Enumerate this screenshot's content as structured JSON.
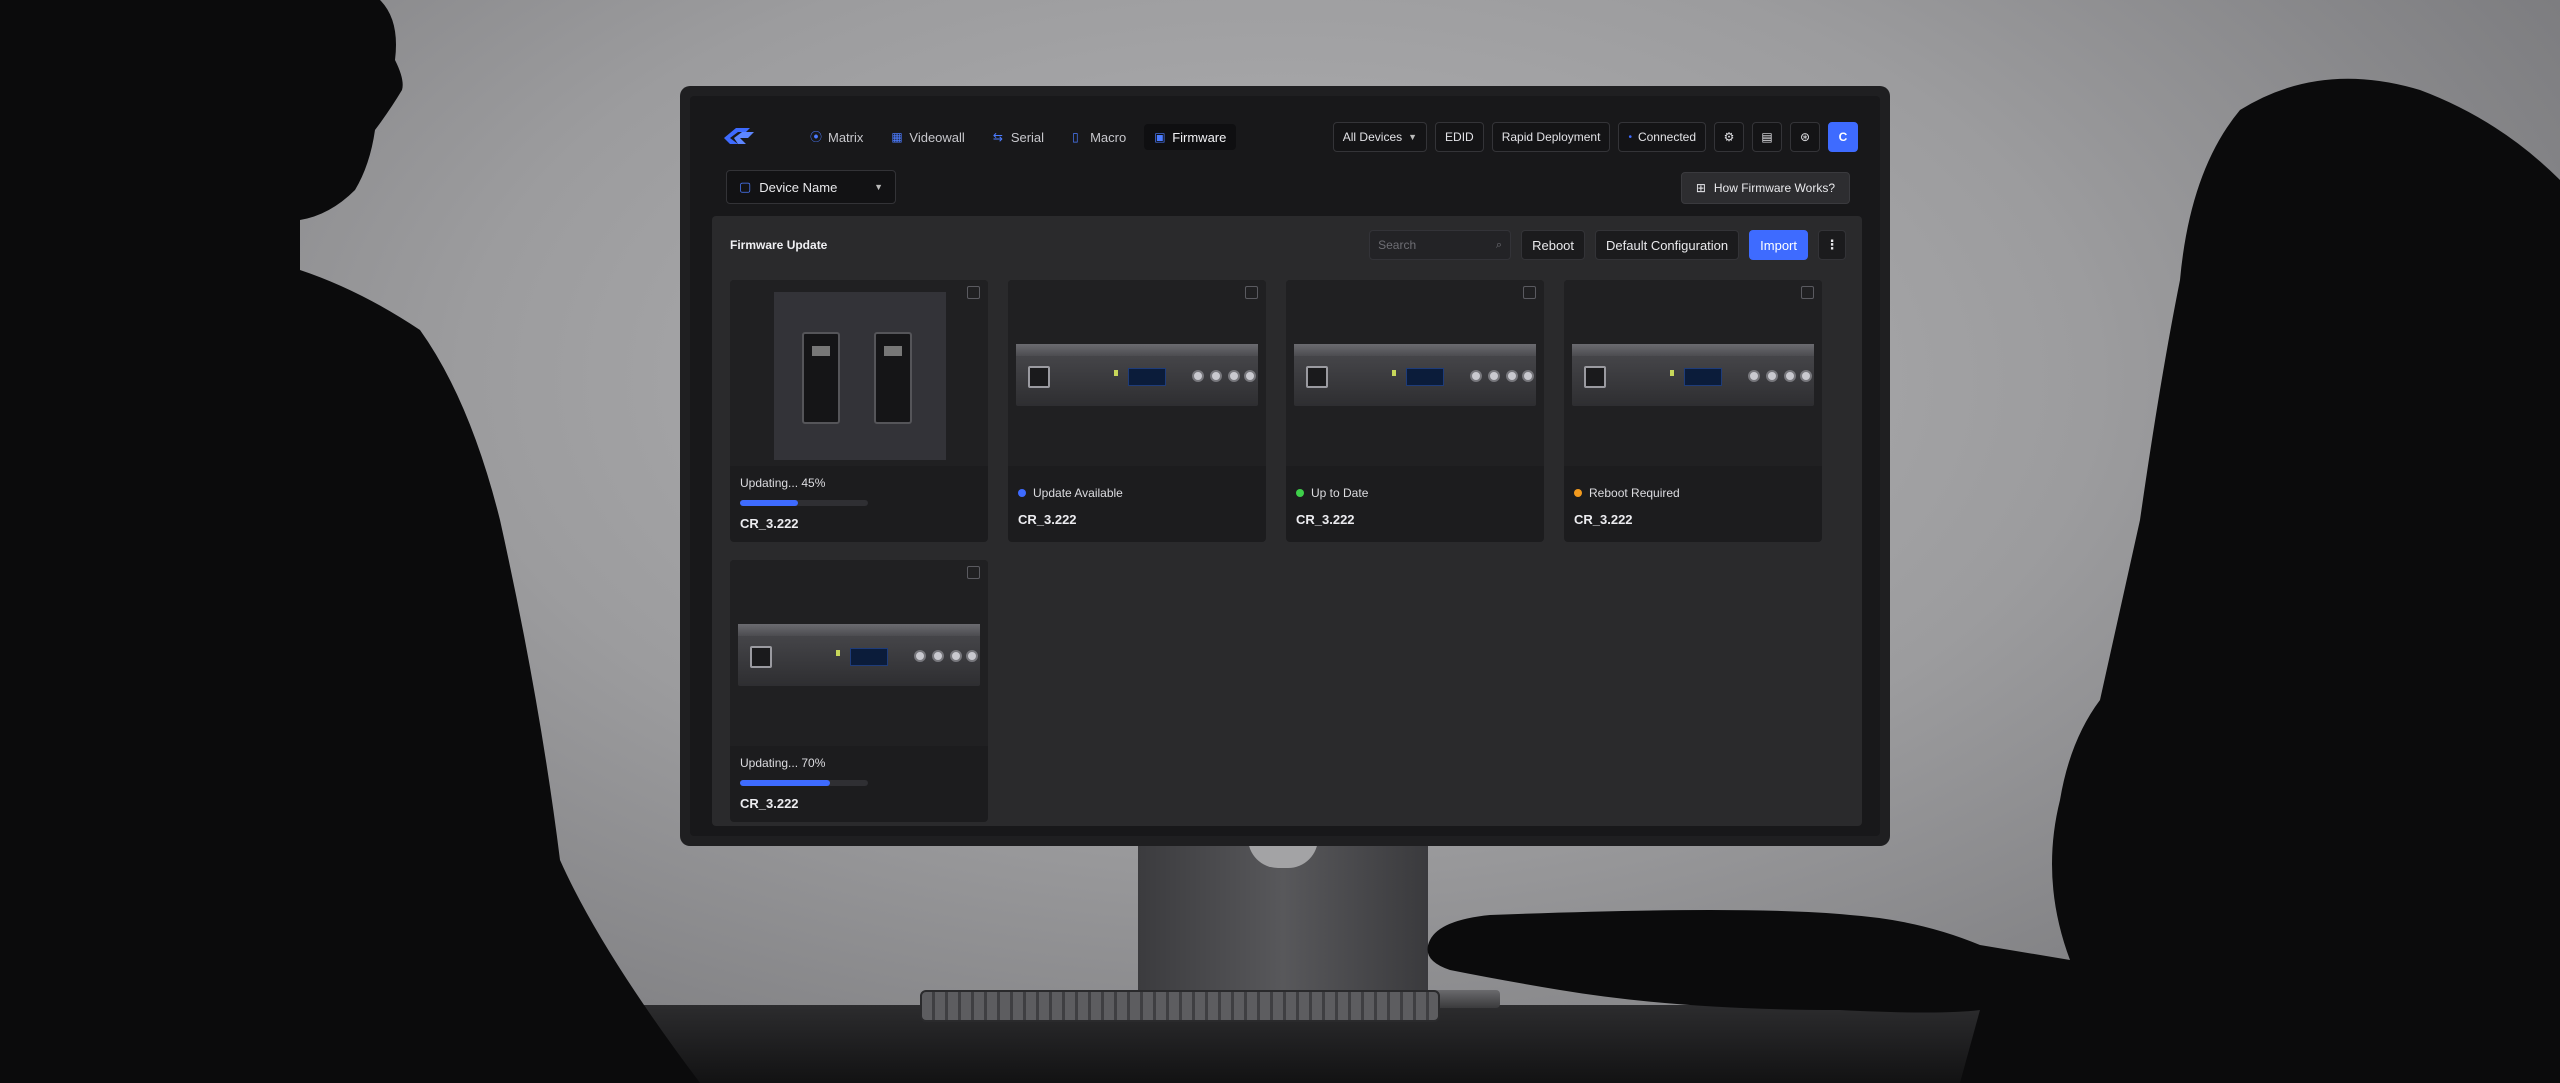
{
  "nav": {
    "items": [
      {
        "label": "Matrix",
        "icon": "matrix-icon"
      },
      {
        "label": "Videowall",
        "icon": "grid-icon"
      },
      {
        "label": "Serial",
        "icon": "serial-icon"
      },
      {
        "label": "Macro",
        "icon": "document-icon"
      },
      {
        "label": "Firmware",
        "icon": "firmware-icon",
        "active": true
      }
    ]
  },
  "toolbar": {
    "all_devices": "All Devices",
    "edid": "EDID",
    "rapid_deployment": "Rapid Deployment",
    "connected": "Connected",
    "avatar": "C"
  },
  "device_select": {
    "label": "Device Name"
  },
  "help": {
    "label": "How Firmware Works?"
  },
  "panel": {
    "title": "Firmware Update",
    "search_placeholder": "Search",
    "reboot": "Reboot",
    "default_configuration": "Default Configuration",
    "import": "Import"
  },
  "devices": [
    {
      "status": "Updating... 45%",
      "progress": 0.45,
      "version": "CR_3.222",
      "image": "wall-plate"
    },
    {
      "status": "Update Available",
      "status_color": "#3e6bff",
      "version": "CR_3.222",
      "image": "rack-unit"
    },
    {
      "status": "Up to Date",
      "status_color": "#3ecf4a",
      "version": "CR_3.222",
      "image": "rack-unit"
    },
    {
      "status": "Reboot Required",
      "status_color": "#f29a1e",
      "version": "CR_3.222",
      "image": "rack-unit"
    },
    {
      "status": "Updating... 70%",
      "progress": 0.7,
      "version": "CR_3.222",
      "image": "rack-unit"
    }
  ],
  "colors": {
    "accent": "#3e6bff",
    "panel": "#2a2a2c",
    "screen": "#18181a"
  }
}
